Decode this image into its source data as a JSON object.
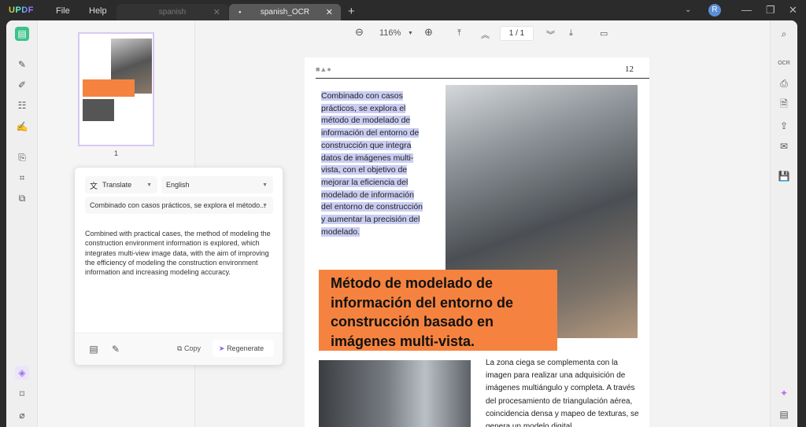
{
  "titlebar": {
    "logo": "UPDF",
    "menu": [
      "File",
      "Help"
    ],
    "tabs": [
      {
        "label": "spanish"
      },
      {
        "label": "spanish_OCR"
      }
    ],
    "avatar": "R"
  },
  "toolbar": {
    "zoom": "116%",
    "page_current": "1",
    "page_total": "1",
    "page_sep": "/"
  },
  "thumbnails": [
    {
      "label": "1"
    }
  ],
  "translate_panel": {
    "mode": "Translate",
    "language": "English",
    "source": "Combinado con casos prácticos, se explora el método...",
    "output": "Combined with practical cases, the method of modeling the construction environment information is explored, which integrates multi-view image data, with the aim of improving the efficiency of modeling the construction environment information and increasing modeling accuracy.",
    "copy_label": "Copy",
    "regenerate_label": "Regenerate",
    "accent": "#8b5cf6"
  },
  "document": {
    "page_number": "12",
    "highlighted_text": "Combinado con casos prácticos, se explora el método de modelado de información del entorno de construcción que integra datos de imágenes multi-vista, con el objetivo de mejorar la eficiencia del modelado de información del entorno de construcción y aumentar la precisión del modelado.",
    "heading": "Método de modelado de información del entorno de construcción basado en imágenes multi-vista.",
    "body": "La zona ciega se complementa con la imagen para realizar una adquisición de imágenes multiángulo y completa. A través del procesamiento de triangulación aérea, coincidencia densa y mapeo de texturas, se genera un modelo digital",
    "heading_color": "#f5833f",
    "highlight_color": "#c9cdf2"
  }
}
